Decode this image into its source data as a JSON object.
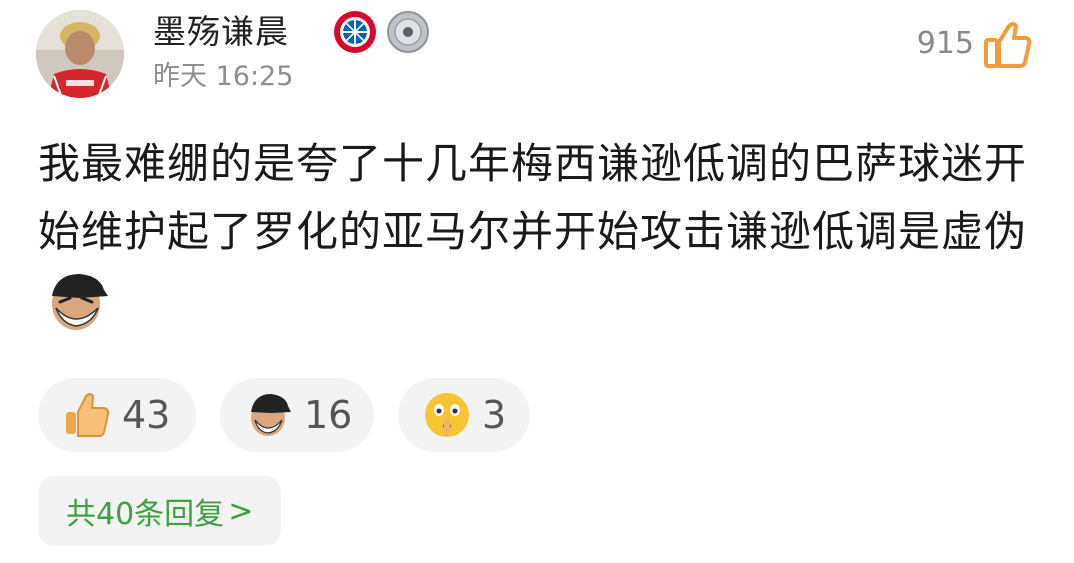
{
  "post": {
    "username": "墨殇谦晨",
    "timestamp": "昨天 16:25",
    "like_count": "915",
    "content": "我最难绷的是夸了十几年梅西谦逊低调的巴萨球迷开始维护起了罗化的亚马尔并开始攻击谦逊低调是虚伪",
    "badges": [
      "bayern-badge-icon",
      "trophy-shield-icon"
    ],
    "inline_sticker": "laughing-man-sticker"
  },
  "reactions": [
    {
      "icon": "thumbs-up-icon",
      "count": "43"
    },
    {
      "icon": "laughing-man-icon",
      "count": "16"
    },
    {
      "icon": "shush-face-icon",
      "count": "3"
    }
  ],
  "replies": {
    "label": "共40条回复",
    "chevron": ">"
  },
  "colors": {
    "accent_green": "#3aa33d",
    "muted_gray": "#8f8f8f",
    "like_orange": "#f29b38"
  }
}
